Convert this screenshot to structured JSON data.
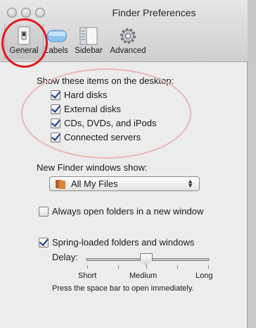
{
  "window": {
    "title": "Finder Preferences"
  },
  "toolbar": {
    "tabs": [
      {
        "label": "General",
        "icon": "light-switch-icon",
        "selected": true
      },
      {
        "label": "Labels",
        "icon": "label-pill-icon",
        "selected": false
      },
      {
        "label": "Sidebar",
        "icon": "sidebar-icon",
        "selected": false
      },
      {
        "label": "Advanced",
        "icon": "gear-icon",
        "selected": false
      }
    ]
  },
  "desktop": {
    "heading": "Show these items on the desktop:",
    "items": [
      {
        "label": "Hard disks",
        "checked": true
      },
      {
        "label": "External disks",
        "checked": true
      },
      {
        "label": "CDs, DVDs, and iPods",
        "checked": true
      },
      {
        "label": "Connected servers",
        "checked": true
      }
    ]
  },
  "new_window": {
    "label": "New Finder windows show:",
    "selected": "All My Files",
    "icon": "all-my-files-icon"
  },
  "always_open": {
    "label": "Always open folders in a new window",
    "checked": false
  },
  "spring_loaded": {
    "label": "Spring-loaded folders and windows",
    "checked": true,
    "delay_label": "Delay:",
    "delay_value": 0.5,
    "ticks": [
      "Short",
      "Medium",
      "Long"
    ],
    "hint": "Press the space bar to open immediately."
  },
  "colors": {
    "annotation_red": "#e0191e",
    "annotation_pink": "#e9b8b8",
    "check_blue": "#1d3f8f"
  }
}
